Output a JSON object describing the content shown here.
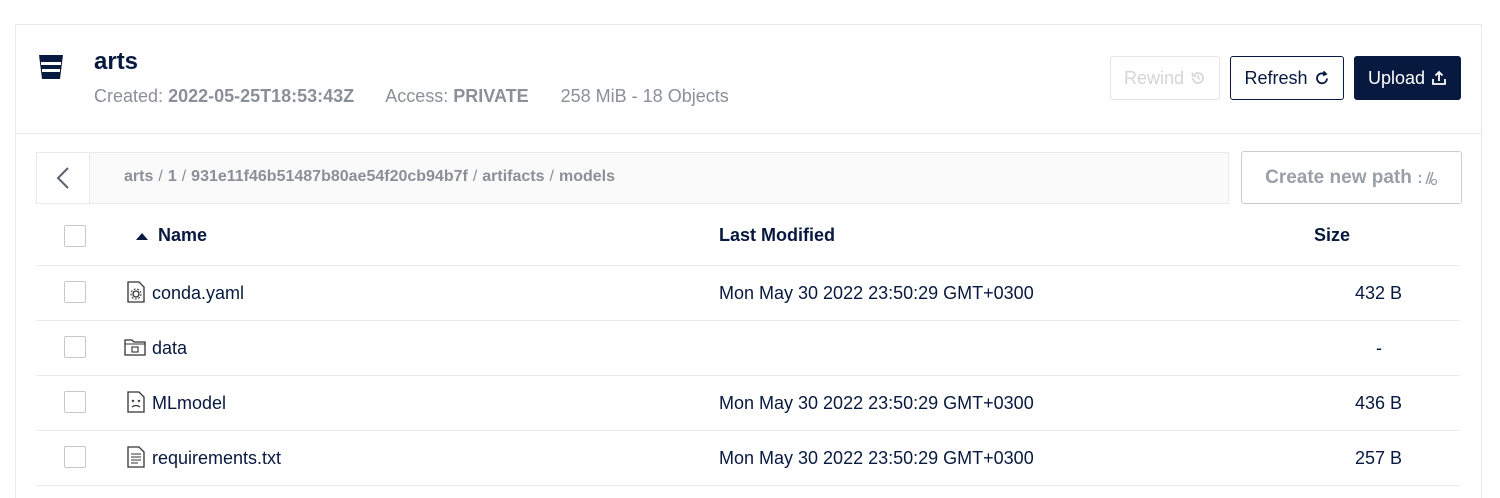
{
  "bucket": {
    "name": "arts",
    "created_label": "Created:",
    "created_value": "2022-05-25T18:53:43Z",
    "access_label": "Access:",
    "access_value": "PRIVATE",
    "usage": "258 MiB - 18 Objects"
  },
  "toolbar": {
    "rewind_label": "Rewind",
    "refresh_label": "Refresh",
    "upload_label": "Upload",
    "create_path_label": "Create new path"
  },
  "breadcrumb": [
    "arts",
    "1",
    "931e11f46b51487b80ae54f20cb94b7f",
    "artifacts",
    "models"
  ],
  "breadcrumb_separator": "/",
  "table": {
    "headers": {
      "name": "Name",
      "modified": "Last Modified",
      "size": "Size"
    },
    "sort_icon": "sort-ascending-icon",
    "rows": [
      {
        "icon": "config-file-icon",
        "name": "conda.yaml",
        "modified": "Mon May 30 2022 23:50:29 GMT+0300",
        "size": "432 B"
      },
      {
        "icon": "folder-icon",
        "name": "data",
        "modified": "",
        "size": "-"
      },
      {
        "icon": "unknown-file-icon",
        "name": "MLmodel",
        "modified": "Mon May 30 2022 23:50:29 GMT+0300",
        "size": "436 B"
      },
      {
        "icon": "text-file-icon",
        "name": "requirements.txt",
        "modified": "Mon May 30 2022 23:50:29 GMT+0300",
        "size": "257 B"
      }
    ]
  },
  "colors": {
    "primary": "#07193E",
    "muted": "#8a8f98",
    "border": "#eaeaea"
  }
}
